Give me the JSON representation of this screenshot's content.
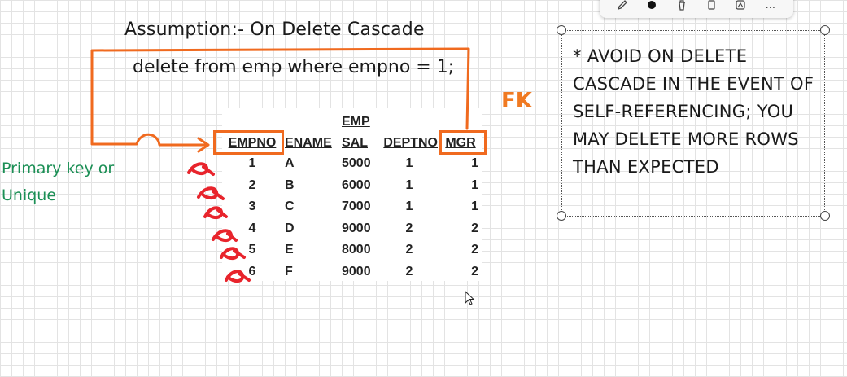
{
  "whiteboard": {
    "assumption": "Assumption:- On Delete Cascade",
    "query": "delete from emp where empno = 1;",
    "pk_label": "Primary key or Unique",
    "fk_label": "FK",
    "note": "* AVOID ON DELETE CASCADE IN THE EVENT OF SELF-REFERENCING; YOU MAY DELETE MORE ROWS THAN EXPECTED"
  },
  "table": {
    "headers": {
      "empno": "EMPNO",
      "ename": "ENAME",
      "sal_top": "EMP",
      "sal": "SAL",
      "deptno": "DEPTNO",
      "mgr": "MGR"
    },
    "rows": [
      {
        "empno": "1",
        "ename": "A",
        "sal": "5000",
        "deptno": "1",
        "mgr": "1"
      },
      {
        "empno": "2",
        "ename": "B",
        "sal": "6000",
        "deptno": "1",
        "mgr": "1"
      },
      {
        "empno": "3",
        "ename": "C",
        "sal": "7000",
        "deptno": "1",
        "mgr": "1"
      },
      {
        "empno": "4",
        "ename": "D",
        "sal": "9000",
        "deptno": "2",
        "mgr": "2"
      },
      {
        "empno": "5",
        "ename": "E",
        "sal": "8000",
        "deptno": "2",
        "mgr": "2"
      },
      {
        "empno": "6",
        "ename": "F",
        "sal": "9000",
        "deptno": "2",
        "mgr": "2"
      }
    ]
  },
  "toolbar": {
    "icons": [
      "pen-icon",
      "color-dot-icon",
      "delete-icon",
      "copy-icon",
      "lasso-icon",
      "more-icon"
    ],
    "more_label": "..."
  },
  "colors": {
    "annotation_orange": "#f06a1f",
    "strike_red": "#e8242c",
    "pk_green": "#1b8f55"
  }
}
